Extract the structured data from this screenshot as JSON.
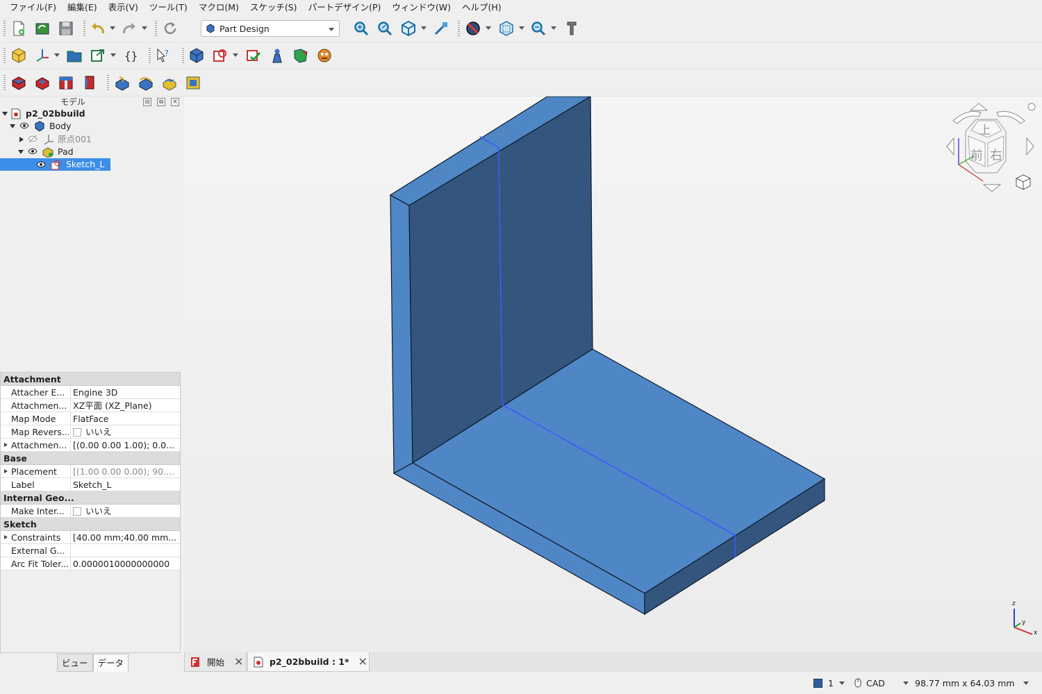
{
  "menu": [
    "ファイル(F)",
    "編集(E)",
    "表示(V)",
    "ツール(T)",
    "マクロ(M)",
    "スケッチ(S)",
    "パートデザイン(P)",
    "ウィンドウ(W)",
    "ヘルプ(H)"
  ],
  "toolbar": {
    "workbench": "Part Design"
  },
  "panel": {
    "title": "モデル"
  },
  "tree": {
    "doc": "p2_02bbuild",
    "body": "Body",
    "origin": "原点001",
    "pad": "Pad",
    "sketch": "Sketch_L"
  },
  "properties": {
    "groups": {
      "attachment": "Attachment",
      "base": "Base",
      "internal": "Internal Geo...",
      "sketch": "Sketch"
    },
    "rows": [
      {
        "name": "Attacher E...",
        "value": "Engine 3D"
      },
      {
        "name": "Attachmen...",
        "value": "XZ平面 (XZ_Plane)"
      },
      {
        "name": "Map Mode",
        "value": "FlatFace"
      },
      {
        "name": "Map Revers...",
        "value": "いいえ"
      },
      {
        "name": "Attachmen...",
        "value": "[(0.00 0.00 1.00); 0.0..."
      },
      {
        "name": "Placement",
        "value": "[(1.00 0.00 0.00); 90...."
      },
      {
        "name": "Label",
        "value": "Sketch_L"
      },
      {
        "name": "Make Inter...",
        "value": "いいえ"
      },
      {
        "name": "Constraints",
        "value": "[40.00 mm;40.00 mm..."
      },
      {
        "name": "External G...",
        "value": ""
      },
      {
        "name": "Arc Fit Toler...",
        "value": "0.0000010000000000"
      }
    ]
  },
  "panel_tabs": [
    "ビュー",
    "データ"
  ],
  "navcube": {
    "top": "上",
    "front": "前",
    "right": "右"
  },
  "axes": {
    "z": "z",
    "y": "y",
    "x": "x"
  },
  "doc_tabs": [
    {
      "label": "開始"
    },
    {
      "label": "p2_02bbuild : 1*"
    }
  ],
  "status": {
    "page": "1",
    "nav_style": "CAD",
    "dimensions": "98.77 mm x 64.03 mm"
  },
  "colors": {
    "face_light": "#4f86c6",
    "face_dark": "#34567e",
    "selection": "#3d8ee8",
    "sketch_line": "#3a5cff"
  }
}
